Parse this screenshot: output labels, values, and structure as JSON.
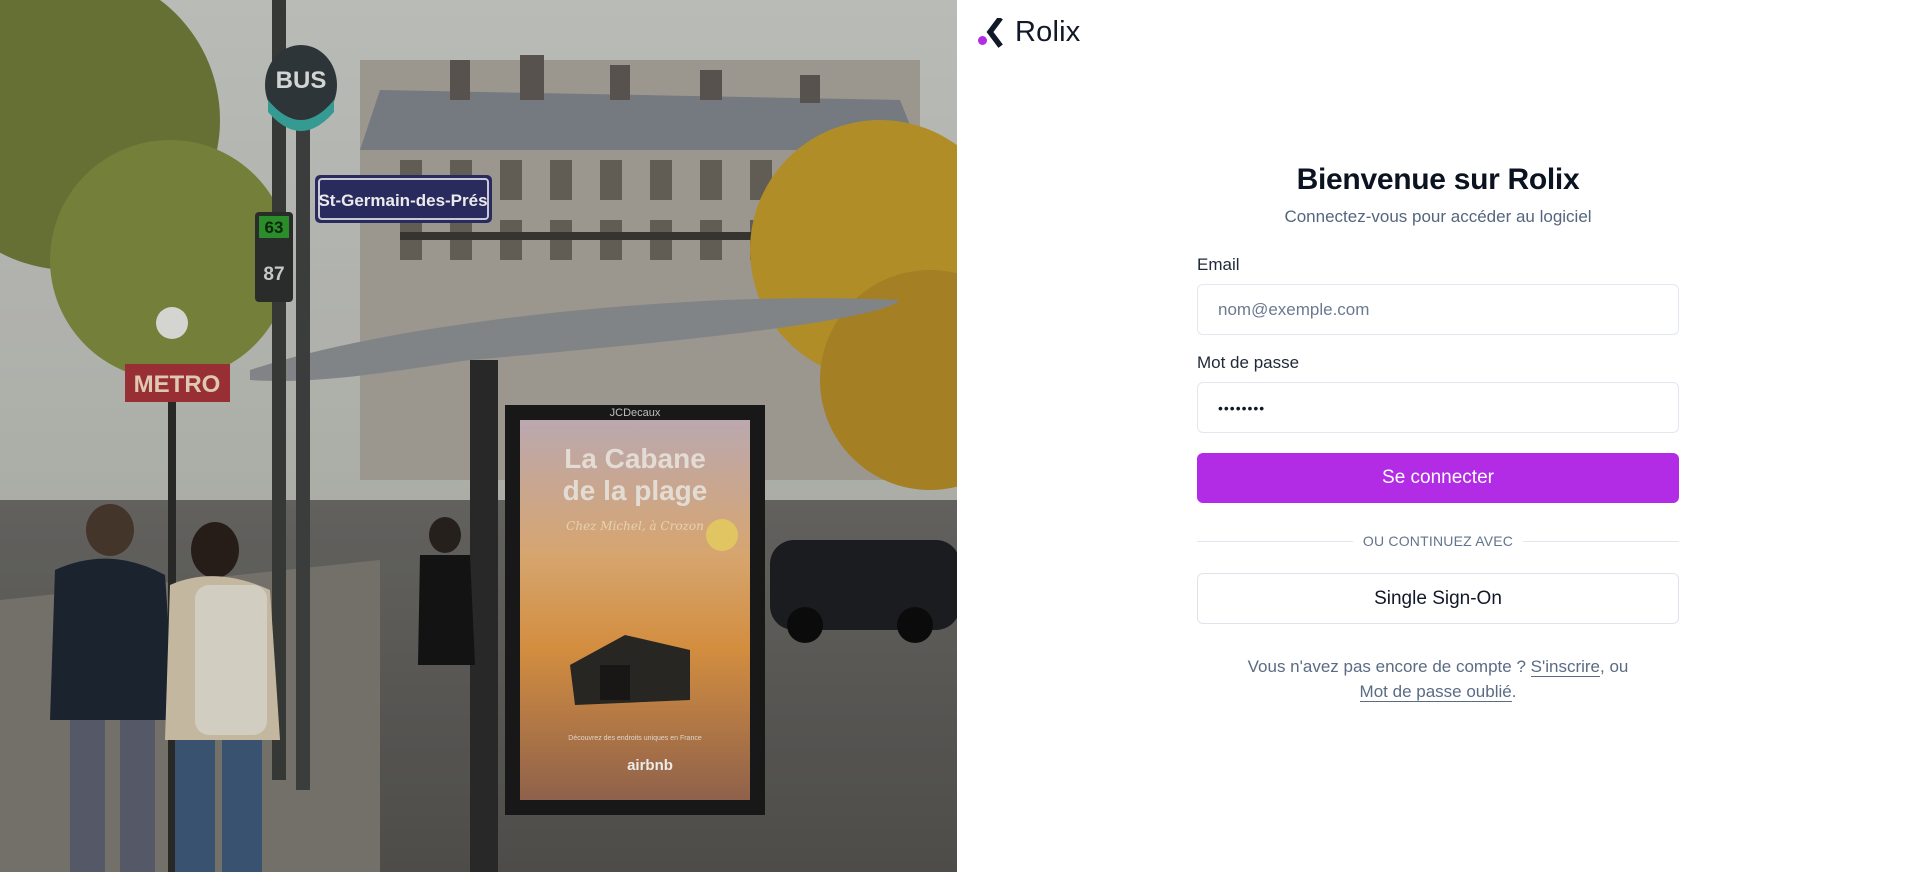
{
  "brand": {
    "name": "Rolix",
    "accent": "#b12ce4"
  },
  "hero": {
    "bus_sign": "BUS",
    "street_sign": "St-Germain-des-Prés",
    "line_a": "63",
    "line_b": "87",
    "metro_sign": "METRO",
    "poster_brand": "JCDecaux",
    "poster_title_1": "La Cabane",
    "poster_title_2": "de la plage",
    "poster_subtitle": "Chez Michel, à Crozon",
    "poster_tagline": "Découvrez des endroits uniques en France",
    "poster_logo": "airbnb"
  },
  "login": {
    "title": "Bienvenue sur Rolix",
    "subtitle": "Connectez-vous pour accéder au logiciel",
    "email_label": "Email",
    "email_placeholder": "nom@exemple.com",
    "password_label": "Mot de passe",
    "password_value": "••••••••",
    "submit_label": "Se connecter",
    "divider_text": "OU CONTINUEZ AVEC",
    "sso_label": "Single Sign-On",
    "footer_prefix": "Vous n'avez pas encore de compte ? ",
    "signup_link": "S'inscrire",
    "footer_mid": ", ou",
    "forgot_link": "Mot de passe oublié",
    "footer_suffix": "."
  }
}
